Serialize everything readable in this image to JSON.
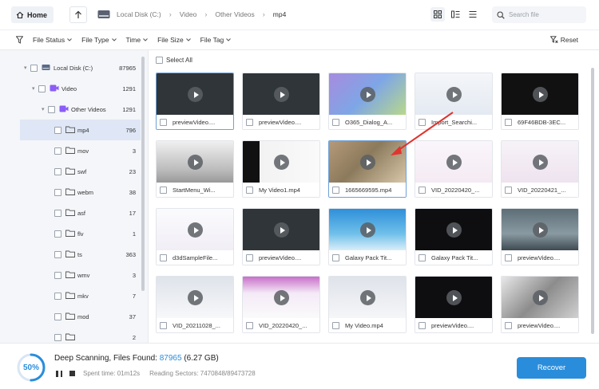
{
  "toolbar": {
    "home_label": "Home",
    "breadcrumb": [
      "Local Disk (C:)",
      "Video",
      "Other Videos",
      "mp4"
    ],
    "search_placeholder": "Search file"
  },
  "filters": {
    "items": [
      "File Status",
      "File Type",
      "Time",
      "File Size",
      "File Tag"
    ],
    "reset_label": "Reset"
  },
  "tree": [
    {
      "label": "Local Disk (C:)",
      "count": "87965"
    },
    {
      "label": "Video",
      "count": "1291"
    },
    {
      "label": "Other Videos",
      "count": "1291"
    },
    {
      "label": "mp4",
      "count": "796"
    },
    {
      "label": "mov",
      "count": "3"
    },
    {
      "label": "swf",
      "count": "23"
    },
    {
      "label": "webm",
      "count": "38"
    },
    {
      "label": "asf",
      "count": "17"
    },
    {
      "label": "flv",
      "count": "1"
    },
    {
      "label": "ts",
      "count": "363"
    },
    {
      "label": "wmv",
      "count": "3"
    },
    {
      "label": "mkv",
      "count": "7"
    },
    {
      "label": "mod",
      "count": "37"
    },
    {
      "label": "",
      "count": "2"
    }
  ],
  "select_all": "Select All",
  "files": [
    [
      "previewVideo....",
      "previewVideo....",
      "O365_Dialog_A...",
      "Import_Searchi...",
      "69F46BDB-3EC..."
    ],
    [
      "StartMenu_Wi...",
      "My Video1.mp4",
      "1665669595.mp4",
      "VID_20220420_...",
      "VID_20220421_..."
    ],
    [
      "d3dSampleFile...",
      "previewVideo....",
      "Galaxy Pack Tit...",
      "Galaxy Pack Tit...",
      "previewVideo...."
    ],
    [
      "VID_20211028_...",
      "VID_20220420_...",
      "My Video.mp4",
      "previewVideo....",
      "previewVideo...."
    ]
  ],
  "status": {
    "percent": "50%",
    "progress": 0.5,
    "scan_label": "Deep Scanning, Files Found: ",
    "found": "87965",
    "size": " (6.27 GB)",
    "spent": "Spent time: 01m12s",
    "sectors": "Reading Sectors: 7470848/89473728"
  },
  "recover_label": "Recover",
  "colors": {
    "accent": "#2a8ddb",
    "selected_row": "#dfe7f6"
  }
}
